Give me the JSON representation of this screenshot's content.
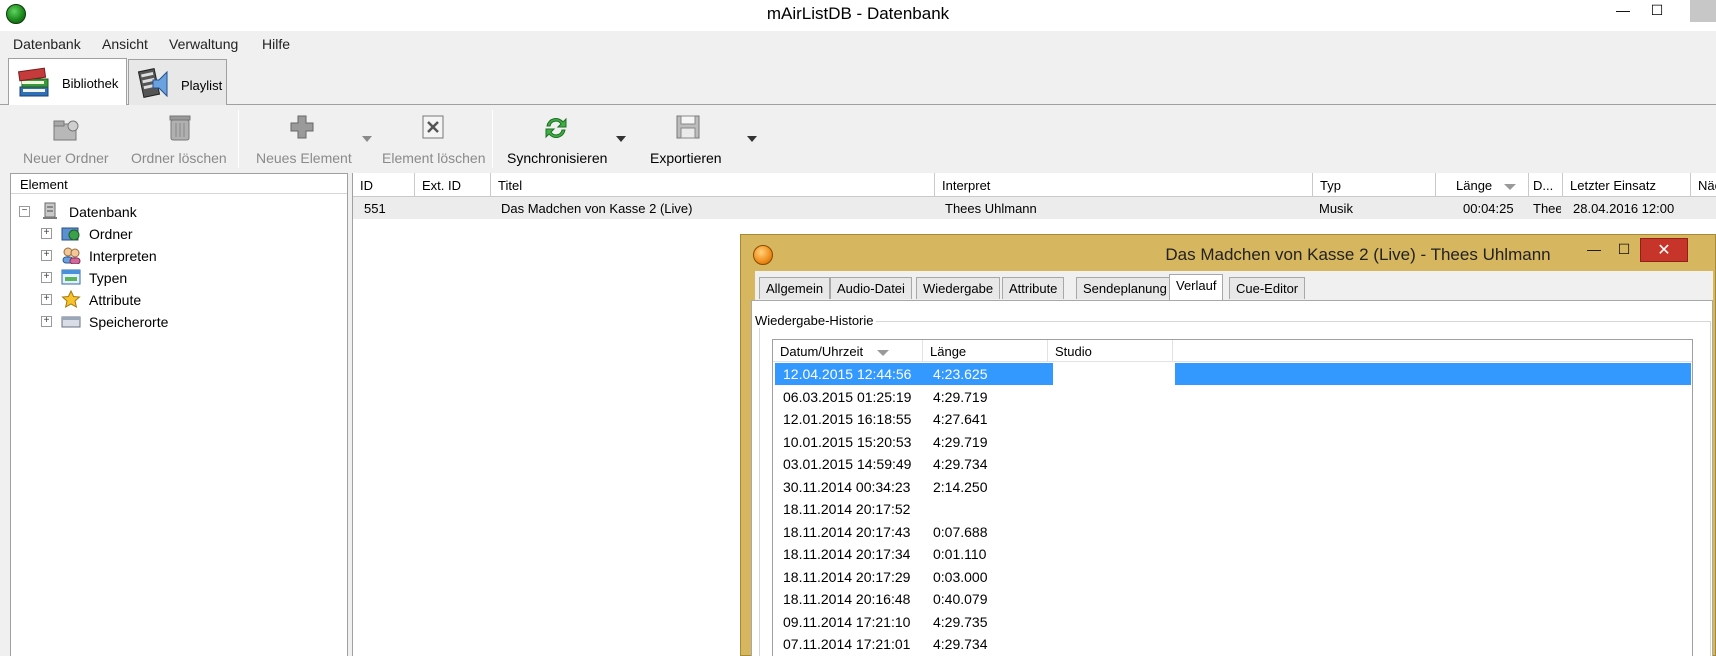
{
  "window": {
    "title": "mAirListDB - Datenbank",
    "min_label": "—",
    "max_label": "☐"
  },
  "menu": [
    "Datenbank",
    "Ansicht",
    "Verwaltung",
    "Hilfe"
  ],
  "big_tabs": [
    {
      "label": "Bibliothek",
      "active": true
    },
    {
      "label": "Playlist",
      "active": false
    }
  ],
  "toolbar": {
    "new_folder": "Neuer Ordner",
    "delete_folder": "Ordner löschen",
    "new_element": "Neues Element",
    "delete_element": "Element löschen",
    "synchronize": "Synchronisieren",
    "export": "Exportieren"
  },
  "tree": {
    "header": "Element",
    "root": "Datenbank",
    "children": [
      "Ordner",
      "Interpreten",
      "Typen",
      "Attribute",
      "Speicherorte"
    ]
  },
  "list": {
    "columns": [
      "ID",
      "Ext. ID",
      "Titel",
      "Interpret",
      "Typ",
      "Länge",
      "D...",
      "Letzter Einsatz",
      "Näc"
    ],
    "row": {
      "id": "551",
      "ext_id": "",
      "title": "Das Madchen von Kasse 2 (Live)",
      "artist": "Thees Uhlmann",
      "type": "Musik",
      "length": "00:04:25",
      "d": "Thee",
      "last_used": "28.04.2016 12:00"
    }
  },
  "dialog": {
    "title": "Das Madchen von Kasse 2 (Live) - Thees Uhlmann",
    "close_label": "✕",
    "min_label": "—",
    "max_label": "☐",
    "tabs": [
      "Allgemein",
      "Audio-Datei",
      "Wiedergabe",
      "Attribute",
      "Sendeplanung",
      "Verlauf",
      "Cue-Editor"
    ],
    "active_tab": "Verlauf",
    "group_title": "Wiedergabe-Historie",
    "history_columns": [
      "Datum/Uhrzeit",
      "Länge",
      "Studio"
    ],
    "history": [
      {
        "datetime": "12.04.2015 12:44:56",
        "length": "4:23.625",
        "selected": true
      },
      {
        "datetime": "06.03.2015 01:25:19",
        "length": "4:29.719"
      },
      {
        "datetime": "12.01.2015 16:18:55",
        "length": "4:27.641"
      },
      {
        "datetime": "10.01.2015 15:20:53",
        "length": "4:29.719"
      },
      {
        "datetime": "03.01.2015 14:59:49",
        "length": "4:29.734"
      },
      {
        "datetime": "30.11.2014 00:34:23",
        "length": "2:14.250"
      },
      {
        "datetime": "18.11.2014 20:17:52",
        "length": ""
      },
      {
        "datetime": "18.11.2014 20:17:43",
        "length": "0:07.688"
      },
      {
        "datetime": "18.11.2014 20:17:34",
        "length": "0:01.110"
      },
      {
        "datetime": "18.11.2014 20:17:29",
        "length": "0:03.000"
      },
      {
        "datetime": "18.11.2014 20:16:48",
        "length": "0:40.079"
      },
      {
        "datetime": "09.11.2014 17:21:10",
        "length": "4:29.735"
      },
      {
        "datetime": "07.11.2014 17:21:01",
        "length": "4:29.734"
      }
    ]
  }
}
